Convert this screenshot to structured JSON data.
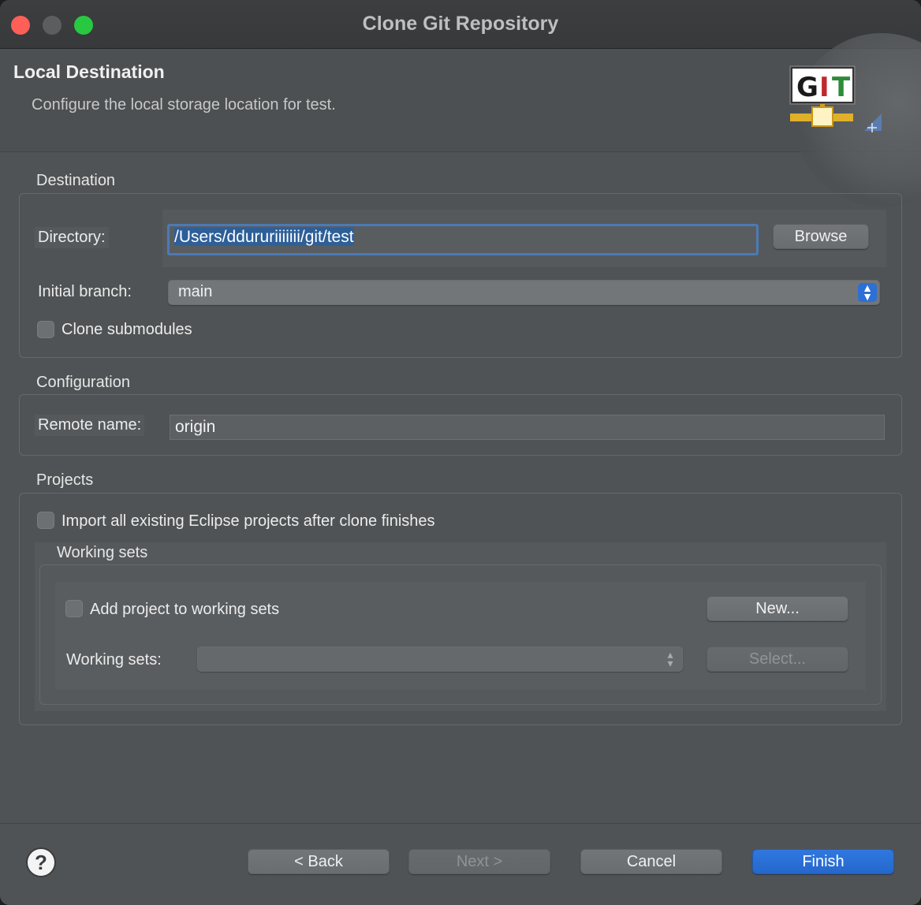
{
  "window": {
    "title": "Clone Git Repository"
  },
  "header": {
    "title": "Local Destination",
    "description": "Configure the local storage location for test.",
    "logo_text": "GIT"
  },
  "destination": {
    "group_label": "Destination",
    "directory_label": "Directory:",
    "directory_value": "/Users/ddururiiiiiii/git/test",
    "browse_label": "Browse",
    "initial_branch_label": "Initial branch:",
    "initial_branch_value": "main",
    "clone_submodules_label": "Clone submodules",
    "clone_submodules_checked": false
  },
  "configuration": {
    "group_label": "Configuration",
    "remote_name_label": "Remote name:",
    "remote_name_value": "origin"
  },
  "projects": {
    "group_label": "Projects",
    "import_label": "Import all existing Eclipse projects after clone finishes",
    "import_checked": false,
    "working_sets": {
      "group_label": "Working sets",
      "add_label": "Add project to working sets",
      "add_checked": false,
      "new_label": "New...",
      "sets_label": "Working sets:",
      "sets_value": "",
      "select_label": "Select..."
    }
  },
  "footer": {
    "help_label": "?",
    "back_label": "< Back",
    "next_label": "Next >",
    "cancel_label": "Cancel",
    "finish_label": "Finish"
  },
  "colors": {
    "accent": "#2c6fd6",
    "focus_ring": "#4b7ab6",
    "traffic_close": "#fe5f57",
    "traffic_max": "#28c840"
  }
}
